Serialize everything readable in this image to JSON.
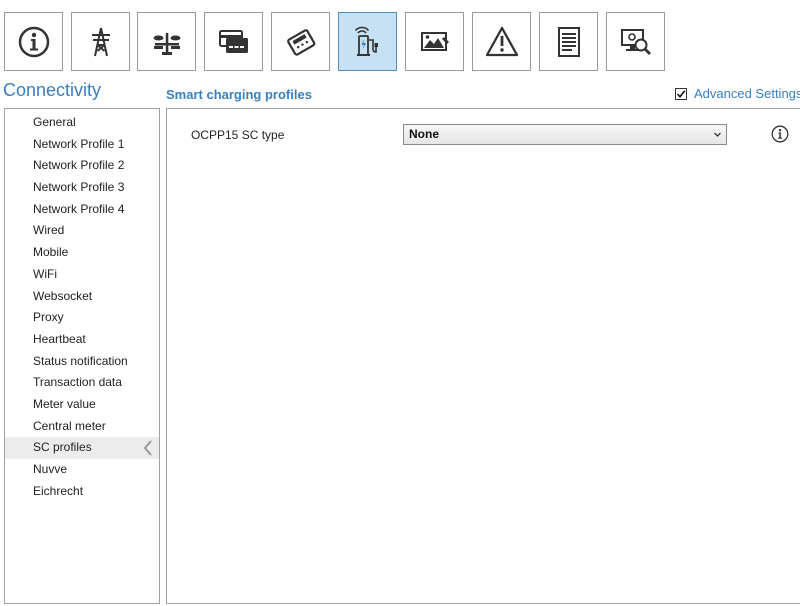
{
  "toolbar": {
    "buttons": [
      {
        "icon": "info-icon",
        "active": false
      },
      {
        "icon": "power-tower-icon",
        "active": false
      },
      {
        "icon": "balance-scale-icon",
        "active": false
      },
      {
        "icon": "payment-card-icon",
        "active": false
      },
      {
        "icon": "card-terminal-icon",
        "active": false
      },
      {
        "icon": "connectivity-charger-icon",
        "active": true
      },
      {
        "icon": "image-display-icon",
        "active": false
      },
      {
        "icon": "warning-icon",
        "active": false
      },
      {
        "icon": "document-icon",
        "active": false
      },
      {
        "icon": "diagnostics-search-icon",
        "active": false
      }
    ]
  },
  "header": {
    "section_title": "Connectivity",
    "sub_title": "Smart charging profiles",
    "advanced_settings_label": "Advanced Settings",
    "advanced_settings_checked": true
  },
  "sidebar": {
    "items": [
      {
        "label": "General"
      },
      {
        "label": "Network Profile 1"
      },
      {
        "label": "Network Profile 2"
      },
      {
        "label": "Network Profile 3"
      },
      {
        "label": "Network Profile 4"
      },
      {
        "label": "Wired"
      },
      {
        "label": "Mobile"
      },
      {
        "label": "WiFi"
      },
      {
        "label": "Websocket"
      },
      {
        "label": "Proxy"
      },
      {
        "label": "Heartbeat"
      },
      {
        "label": "Status notification"
      },
      {
        "label": "Transaction data"
      },
      {
        "label": "Meter value"
      },
      {
        "label": "Central meter"
      },
      {
        "label": "SC profiles",
        "selected": true
      },
      {
        "label": "Nuvve"
      },
      {
        "label": "Eichrecht"
      }
    ]
  },
  "main": {
    "field_label": "OCPP15 SC type",
    "field_value": "None"
  },
  "colors": {
    "accent": "#3a7fbf",
    "active_tab_bg": "#c6e1f3",
    "selected_item_bg": "#ececec"
  }
}
